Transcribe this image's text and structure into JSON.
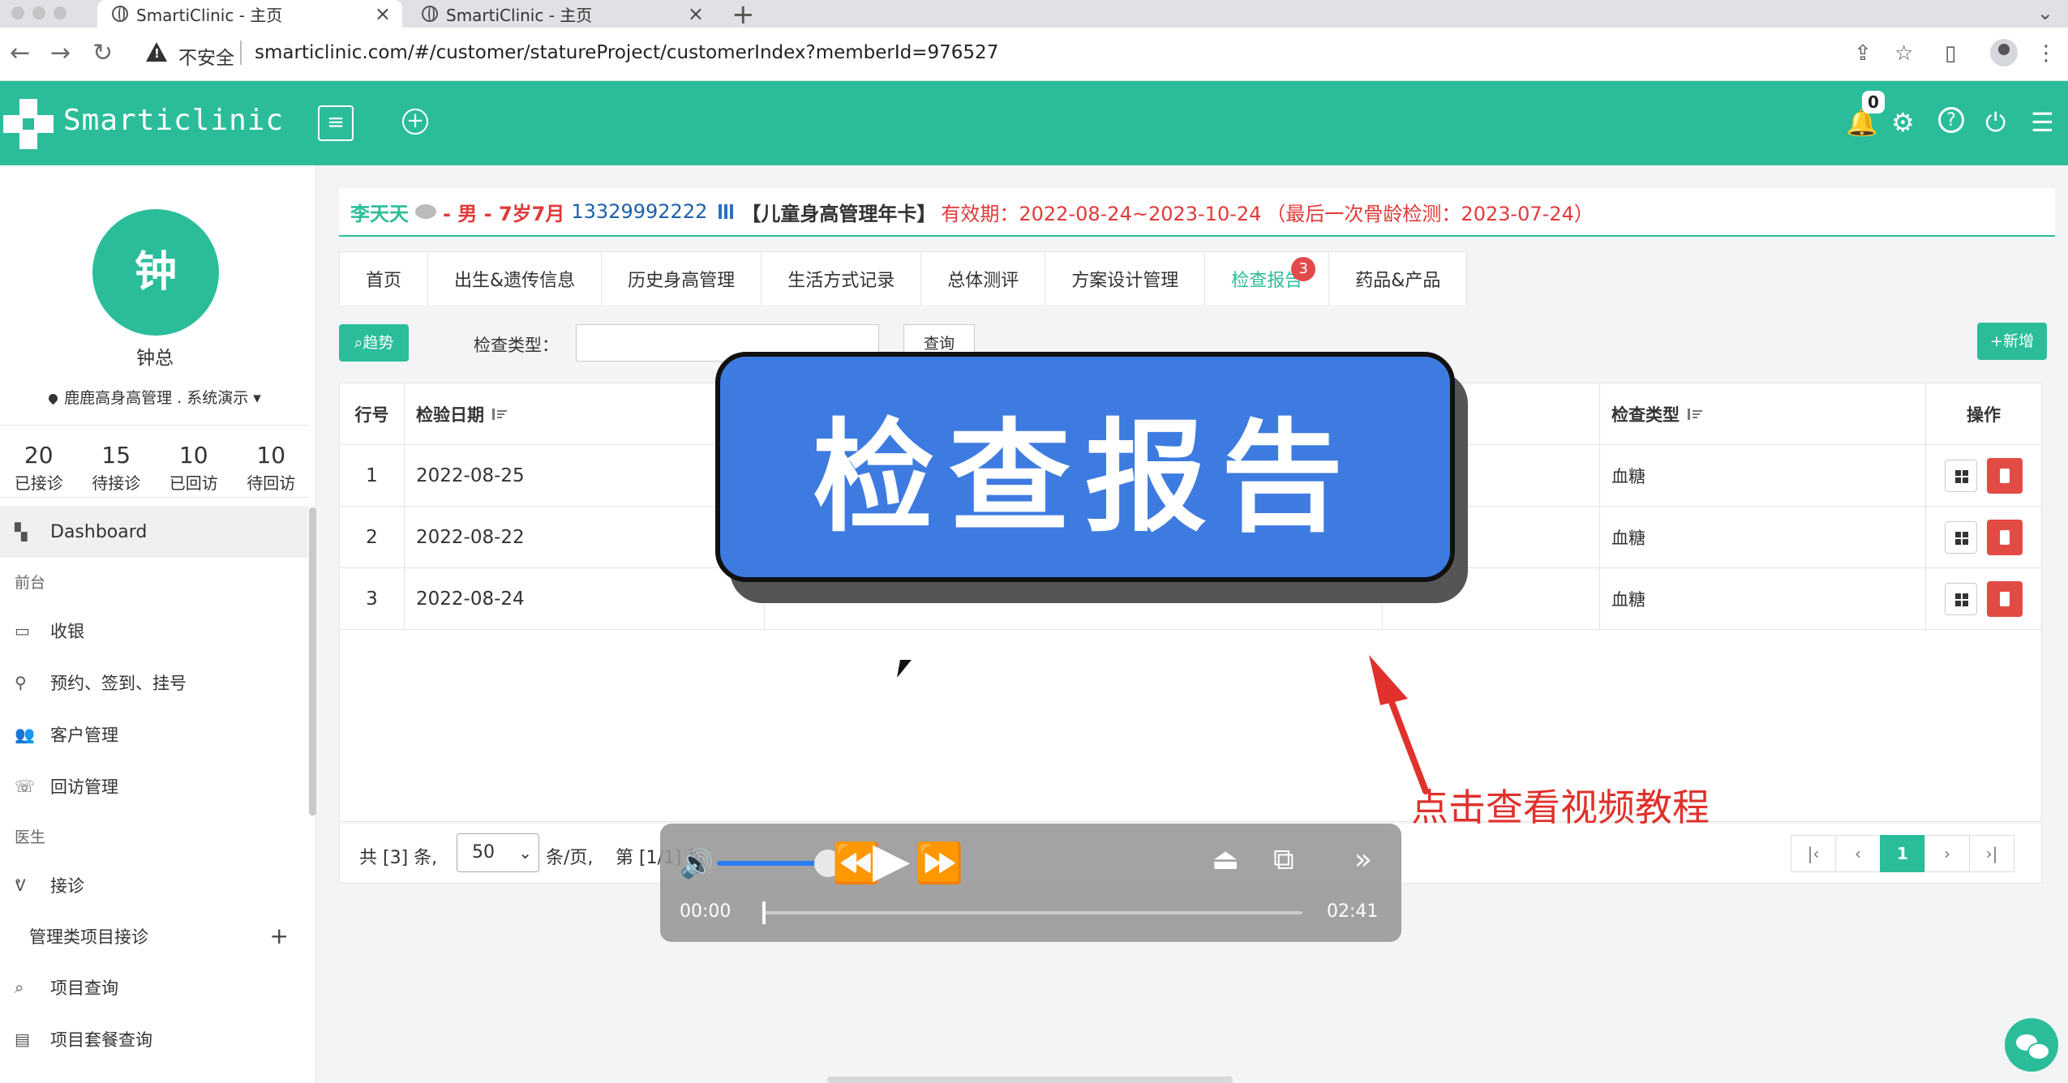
{
  "browser": {
    "tabs": [
      {
        "title": "SmartiClinic - 主页",
        "active": true
      },
      {
        "title": "SmartiClinic - 主页",
        "active": false
      }
    ],
    "insecure_label": "不安全",
    "url": "smarticlinic.com/#/customer/statureProject/customerIndex?memberId=976527"
  },
  "app": {
    "logo": "Smarticlinic",
    "notification_count": "0",
    "brand_color": "#2bbd9a"
  },
  "user": {
    "avatar_char": "钟",
    "name": "钟总",
    "org": "鹿鹿高身高管理 . 系统演示"
  },
  "stats": [
    {
      "value": "20",
      "label": "已接诊"
    },
    {
      "value": "15",
      "label": "待接诊"
    },
    {
      "value": "10",
      "label": "已回访"
    },
    {
      "value": "10",
      "label": "待回访"
    }
  ],
  "nav": {
    "dashboard": "Dashboard",
    "section_front": "前台",
    "cashier": "收银",
    "appointment": "预约、签到、挂号",
    "customer": "客户管理",
    "followup": "回访管理",
    "section_doctor": "医生",
    "reception": "接诊",
    "mgmt_reception": "管理类项目接诊",
    "project_query": "项目查询",
    "package_query": "项目套餐查询"
  },
  "patient": {
    "name": "李天天",
    "gender_age": "- 男 - 7岁7月",
    "phone": "13329992222",
    "card": "【儿童身高管理年卡】",
    "validity": "有效期：2022-08-24~2023-10-24",
    "last_check": "（最后一次骨龄检测：2023-07-24）"
  },
  "tabs": [
    {
      "label": "首页"
    },
    {
      "label": "出生&遗传信息"
    },
    {
      "label": "历史身高管理"
    },
    {
      "label": "生活方式记录"
    },
    {
      "label": "总体测评"
    },
    {
      "label": "方案设计管理"
    },
    {
      "label": "检查报告",
      "active": true,
      "badge": "3"
    },
    {
      "label": "药品&产品"
    }
  ],
  "toolbar": {
    "trend": "趋势",
    "filter_label": "检查类型：",
    "query": "查询",
    "add": "+新增"
  },
  "table": {
    "headers": {
      "row": "行号",
      "date": "检验日期",
      "type": "检查类型",
      "ops": "操作"
    },
    "rows": [
      {
        "no": "1",
        "date": "2022-08-25",
        "type": "血糖"
      },
      {
        "no": "2",
        "date": "2022-08-22",
        "type": "血糖"
      },
      {
        "no": "3",
        "date": "2022-08-24",
        "type": "血糖"
      }
    ]
  },
  "pager": {
    "total": "共 [3] 条,",
    "page_size": "50",
    "per_page": "条/页,",
    "page_info": "第 [1/1] 页",
    "current": "1"
  },
  "overlay": {
    "banner": "检查报告",
    "caption": "点击查看视频教程"
  },
  "player": {
    "current_time": "00:00",
    "total_time": "02:41",
    "volume": 0.7,
    "progress": 0.0
  }
}
